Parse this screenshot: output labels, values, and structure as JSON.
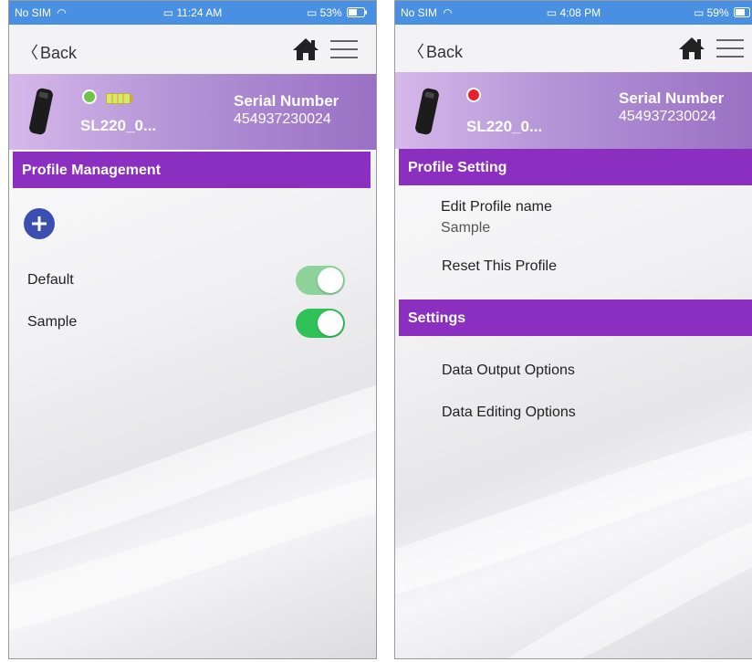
{
  "colors": {
    "status_bar": "#4a90e2",
    "section_header": "#8a2fbf",
    "toggle_on": "#30c158",
    "toggle_on_dimmed": "#8ed39a",
    "connected_dot": "#6fc24b",
    "disconnected_dot": "#e8212b",
    "add_button": "#3b4fb0"
  },
  "left_screen": {
    "status": {
      "carrier": "No SIM",
      "time": "11:24 AM",
      "battery": "53%"
    },
    "nav": {
      "back_label": "Back",
      "home_icon": "home-icon",
      "menu_icon": "hamburger-menu-icon"
    },
    "device": {
      "name": "SL220_0...",
      "serial_label": "Serial Number",
      "serial_value": "454937230024",
      "connection": "connected",
      "battery_icon": "battery-icon"
    },
    "section_title": "Profile Management",
    "add_icon": "plus-icon",
    "profiles": [
      {
        "label": "Default",
        "enabled": true,
        "dimmed": true
      },
      {
        "label": "Sample",
        "enabled": true,
        "dimmed": false
      }
    ]
  },
  "right_screen": {
    "status": {
      "carrier": "No SIM",
      "time": "4:08 PM",
      "battery": "59%"
    },
    "nav": {
      "back_label": "Back",
      "home_icon": "home-icon",
      "menu_icon": "hamburger-menu-icon"
    },
    "device": {
      "name": "SL220_0...",
      "serial_label": "Serial Number",
      "serial_value": "454937230024",
      "connection": "disconnected"
    },
    "profile_section": {
      "title": "Profile Setting",
      "edit_name_label": "Edit Profile name",
      "edit_name_value": "Sample",
      "reset_label": "Reset This Profile"
    },
    "settings_section": {
      "title": "Settings",
      "items": [
        "Data Output Options",
        "Data Editing Options"
      ]
    }
  }
}
